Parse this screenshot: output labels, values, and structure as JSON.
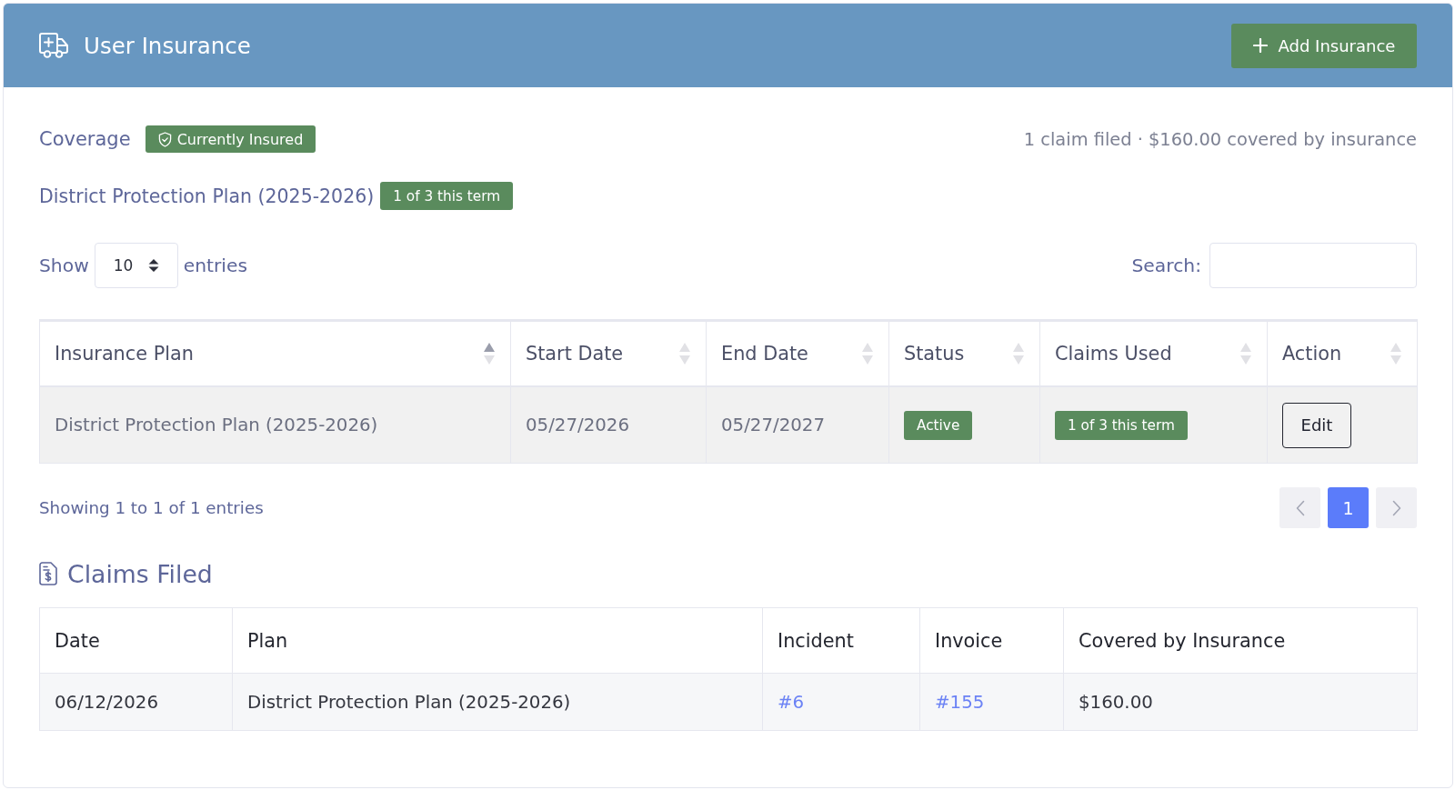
{
  "header": {
    "title": "User Insurance",
    "add_button": {
      "label": "Add Insurance"
    }
  },
  "coverage": {
    "label": "Coverage",
    "status": "Currently Insured",
    "summary": "1 claim filed · $160.00 covered by insurance"
  },
  "current_plan": {
    "name": "District Protection Plan (2025-2026)",
    "usage": "1 of 3 this term"
  },
  "entries_control": {
    "label_before": "Show",
    "value": "10",
    "label_after": "entries"
  },
  "search": {
    "label": "Search:"
  },
  "plans_table": {
    "columns": [
      {
        "label": "Insurance Plan",
        "sorted": true
      },
      {
        "label": "Start Date",
        "sorted": false
      },
      {
        "label": "End Date",
        "sorted": false
      },
      {
        "label": "Status",
        "sorted": false
      },
      {
        "label": "Claims Used",
        "sorted": false
      },
      {
        "label": "Action",
        "sorted": false
      }
    ],
    "rows": [
      {
        "cells": [
          {
            "kind": "text",
            "text": "District Protection Plan (2025-2026)"
          },
          {
            "kind": "text",
            "text": "05/27/2026"
          },
          {
            "kind": "text",
            "text": "05/27/2027"
          },
          {
            "kind": "badge",
            "text": "Active"
          },
          {
            "kind": "badge",
            "text": "1 of 3 this term"
          },
          {
            "kind": "button",
            "text": "Edit"
          }
        ]
      }
    ]
  },
  "table_info": "Showing 1 to 1 of 1 entries",
  "pagination": {
    "previous": {
      "disabled": true
    },
    "pages": [
      {
        "label": "1",
        "selected": true
      }
    ],
    "next": {
      "disabled": true
    }
  },
  "claims": {
    "title": "Claims Filed",
    "table": {
      "columns": [
        "Date",
        "Plan",
        "Incident",
        "Invoice",
        "Covered by Insurance"
      ],
      "rows": [
        {
          "cells": [
            {
              "kind": "text",
              "text": "06/12/2026"
            },
            {
              "kind": "text",
              "text": "District Protection Plan (2025-2026)"
            },
            {
              "kind": "link",
              "text": "#6"
            },
            {
              "kind": "link",
              "text": "#155"
            },
            {
              "kind": "text",
              "text": "$160.00"
            }
          ]
        }
      ]
    }
  }
}
